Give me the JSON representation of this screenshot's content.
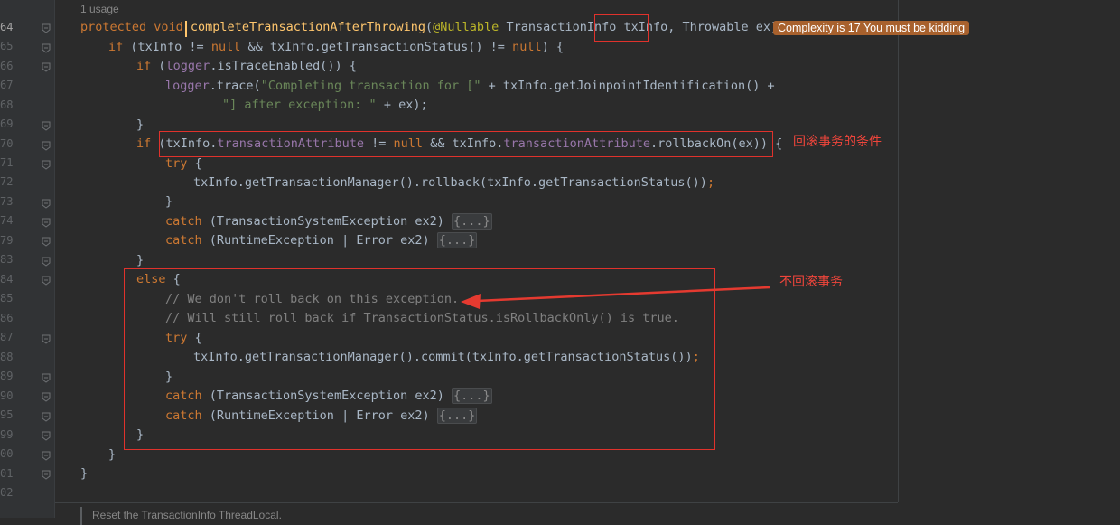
{
  "usage_label": "1 usage",
  "inline_hint": "Complexity is 17 You must be kidding",
  "annotations": {
    "rollback_condition": "回滚事务的条件",
    "no_rollback": "不回滚事务"
  },
  "bottom_doc": "Reset the TransactionInfo ThreadLocal.",
  "gutter_lines": [
    "64",
    "65",
    "66",
    "67",
    "68",
    "69",
    "70",
    "71",
    "72",
    "73",
    "74",
    "79",
    "83",
    "84",
    "85",
    "86",
    "87",
    "88",
    "89",
    "90",
    "95",
    "99",
    "00",
    "01",
    "02"
  ],
  "code": {
    "l64": {
      "kw": "protected void ",
      "fn": "completeTransactionAfterThrowing",
      "p1": "(",
      "ann": "@Nullable",
      "p2": " TransactionInfo ",
      "param": "txInfo",
      "p3": ", Throwable ex) {"
    },
    "l65": {
      "kw1": "if",
      "a": " (txInfo != ",
      "null1": "null",
      "b": " && txInfo.getTransactionStatus() != ",
      "null2": "null",
      "c": ") {"
    },
    "l66": {
      "kw": "if",
      "a": " (",
      "logger": "logger",
      "b": ".isTraceEnabled()) {"
    },
    "l67": {
      "logger": "logger",
      "a": ".trace(",
      "str": "\"Completing transaction for [\"",
      "b": " + txInfo.getJoinpointIdentification() +"
    },
    "l68": {
      "str": "\"] after exception: \"",
      "a": " + ex);"
    },
    "l69": {
      "a": "}"
    },
    "l70": {
      "kw": "if",
      "a": " (txInfo.",
      "f1": "transactionAttribute",
      "b": " != ",
      "nul": "null",
      "c": " && txInfo.",
      "f2": "transactionAttribute",
      "d": ".rollbackOn(ex)) {"
    },
    "l71": {
      "kw": "try",
      "a": " {"
    },
    "l72": {
      "a": "txInfo.getTransactionManager().rollback(txInfo.getTransactionStatus())",
      "semi": ";"
    },
    "l73": {
      "a": "}"
    },
    "l74": {
      "kw": "catch",
      "a": " (TransactionSystemException ex2) ",
      "fold": "{...}"
    },
    "l79": {
      "kw": "catch",
      "a": " (RuntimeException | Error ex2) ",
      "fold": "{...}"
    },
    "l83": {
      "a": "}"
    },
    "l84": {
      "kw": "else",
      "a": " {"
    },
    "l85": {
      "cmt": "// We don't roll back on this exception."
    },
    "l86": {
      "cmt": "// Will still roll back if TransactionStatus.isRollbackOnly() is true."
    },
    "l87": {
      "kw": "try",
      "a": " {"
    },
    "l88": {
      "a": "txInfo.getTransactionManager().commit(txInfo.getTransactionStatus())",
      "semi": ";"
    },
    "l89": {
      "a": "}"
    },
    "l90": {
      "kw": "catch",
      "a": " (TransactionSystemException ex2) ",
      "fold": "{...}"
    },
    "l95": {
      "kw": "catch",
      "a": " (RuntimeException | Error ex2) ",
      "fold": "{...}"
    },
    "l99": {
      "a": "}"
    },
    "l00": {
      "a": "}"
    },
    "l01": {
      "a": "}"
    }
  },
  "colors": {
    "background": "#2b2b2b",
    "keyword": "#cc7832",
    "function": "#ffc66d",
    "annotation": "#bbb529",
    "field": "#9876aa",
    "string": "#6a8759",
    "comment": "#808080",
    "highlight_red": "#e0322c",
    "hint_bg": "#a8612d"
  }
}
